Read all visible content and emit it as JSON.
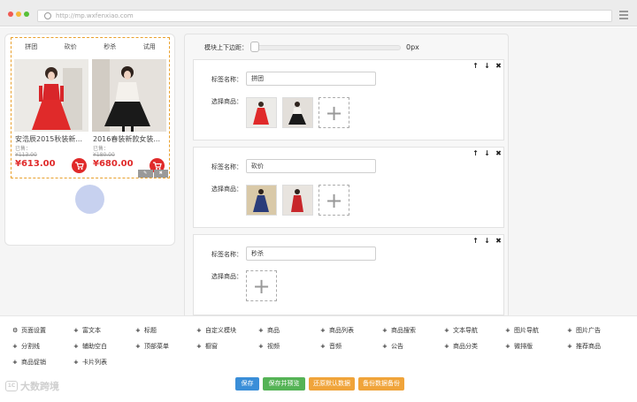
{
  "browser": {
    "url": "http://mp.wxfenxiao.com"
  },
  "preview": {
    "tabs": [
      "拼团",
      "砍价",
      "秒杀",
      "试用"
    ],
    "products": [
      {
        "name": "安浩辰2015秋装新...",
        "sold": "已售：",
        "orig_price": "¥113.00",
        "price": "¥613.00"
      },
      {
        "name": "2016春装新款女装...",
        "sold": "已售：",
        "orig_price": "¥180.00",
        "price": "¥680.00"
      }
    ]
  },
  "editor": {
    "margin_label": "模块上下边距：",
    "margin_value": "0px",
    "margin_fraction": 0,
    "cards": [
      {
        "tag_label": "标签名称：",
        "tag_value": "拼团",
        "goods_label": "选择商品：",
        "add_symbol": "+"
      },
      {
        "tag_label": "标签名称：",
        "tag_value": "砍价",
        "goods_label": "选择商品：",
        "add_symbol": "+"
      },
      {
        "tag_label": "标签名称：",
        "tag_value": "秒杀",
        "goods_label": "选择商品：",
        "add_symbol": "+"
      }
    ],
    "card_controls": {
      "up": "↑",
      "down": "↓",
      "close": "✖"
    }
  },
  "components": [
    {
      "icon": "gear-icon",
      "label": "页面设置"
    },
    {
      "icon": "plus-icon",
      "label": "富文本"
    },
    {
      "icon": "plus-icon",
      "label": "标题"
    },
    {
      "icon": "plus-icon",
      "label": "自定义模块"
    },
    {
      "icon": "plus-icon",
      "label": "商品"
    },
    {
      "icon": "plus-icon",
      "label": "商品列表"
    },
    {
      "icon": "plus-icon",
      "label": "商品搜索"
    },
    {
      "icon": "plus-icon",
      "label": "文本导航"
    },
    {
      "icon": "plus-icon",
      "label": "图片导航"
    },
    {
      "icon": "plus-icon",
      "label": "图片广告"
    },
    {
      "icon": "plus-icon",
      "label": "分割线"
    },
    {
      "icon": "plus-icon",
      "label": "辅助空白"
    },
    {
      "icon": "plus-icon",
      "label": "顶部菜单"
    },
    {
      "icon": "plus-icon",
      "label": "橱窗"
    },
    {
      "icon": "plus-icon",
      "label": "视频"
    },
    {
      "icon": "plus-icon",
      "label": "音频"
    },
    {
      "icon": "plus-icon",
      "label": "公告"
    },
    {
      "icon": "plus-icon",
      "label": "商品分类"
    },
    {
      "icon": "plus-icon",
      "label": "微排版"
    },
    {
      "icon": "plus-icon",
      "label": "推荐商品"
    },
    {
      "icon": "plus-icon",
      "label": "商品促销"
    },
    {
      "icon": "plus-icon",
      "label": "卡片列表"
    }
  ],
  "buttons": {
    "save": "保存",
    "save_preview": "保存并预览",
    "restore_default": "还原默认数据",
    "backup": "备份数据备份"
  },
  "watermark": {
    "text": "大数跨境"
  },
  "colors": {
    "accent_blue": "#3a8ed8",
    "green": "#55b356",
    "orange": "#f0a43a",
    "price_red": "#e02a2a",
    "dashed_border": "#e9a02c"
  }
}
